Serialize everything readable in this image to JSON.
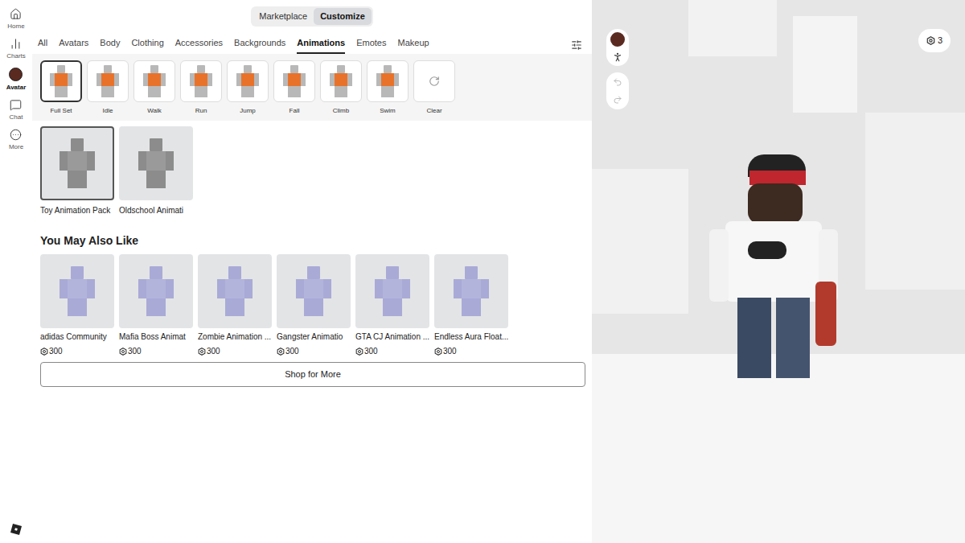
{
  "nav": [
    {
      "label": "Home",
      "selected": false
    },
    {
      "label": "Charts",
      "selected": false
    },
    {
      "label": "Avatar",
      "selected": true
    },
    {
      "label": "Chat",
      "selected": false
    },
    {
      "label": "More",
      "selected": false
    }
  ],
  "mode_toggle": [
    {
      "label": "Marketplace",
      "selected": false
    },
    {
      "label": "Customize",
      "selected": true
    }
  ],
  "category_tabs": [
    {
      "label": "All",
      "selected": false
    },
    {
      "label": "Avatars",
      "selected": false
    },
    {
      "label": "Body",
      "selected": false
    },
    {
      "label": "Clothing",
      "selected": false
    },
    {
      "label": "Accessories",
      "selected": false
    },
    {
      "label": "Backgrounds",
      "selected": false
    },
    {
      "label": "Animations",
      "selected": true
    },
    {
      "label": "Emotes",
      "selected": false
    },
    {
      "label": "Makeup",
      "selected": false
    }
  ],
  "animation_slots": [
    {
      "label": "Full Set",
      "kind": "figure",
      "selected": true
    },
    {
      "label": "Idle",
      "kind": "figure",
      "selected": false
    },
    {
      "label": "Walk",
      "kind": "figure",
      "selected": false
    },
    {
      "label": "Run",
      "kind": "figure",
      "selected": false
    },
    {
      "label": "Jump",
      "kind": "figure",
      "selected": false
    },
    {
      "label": "Fall",
      "kind": "figure",
      "selected": false
    },
    {
      "label": "Climb",
      "kind": "figure",
      "selected": false
    },
    {
      "label": "Swim",
      "kind": "figure",
      "selected": false
    },
    {
      "label": "Clear",
      "kind": "clear",
      "selected": false
    }
  ],
  "owned_items": [
    {
      "name": "Toy Animation Pack",
      "selected": true
    },
    {
      "name": "Oldschool Animati",
      "selected": false
    }
  ],
  "recommended": {
    "title": "You May Also Like",
    "items": [
      {
        "name": "adidas Community",
        "price": "300"
      },
      {
        "name": "Mafia Boss Animat",
        "price": "300"
      },
      {
        "name": "Zombie Animation ...",
        "price": "300"
      },
      {
        "name": "Gangster Animatio",
        "price": "300"
      },
      {
        "name": "GTA CJ Animation ...",
        "price": "300"
      },
      {
        "name": "Endless Aura Float...",
        "price": "300"
      }
    ]
  },
  "shop_button": "Shop for More",
  "robux_balance": "3"
}
